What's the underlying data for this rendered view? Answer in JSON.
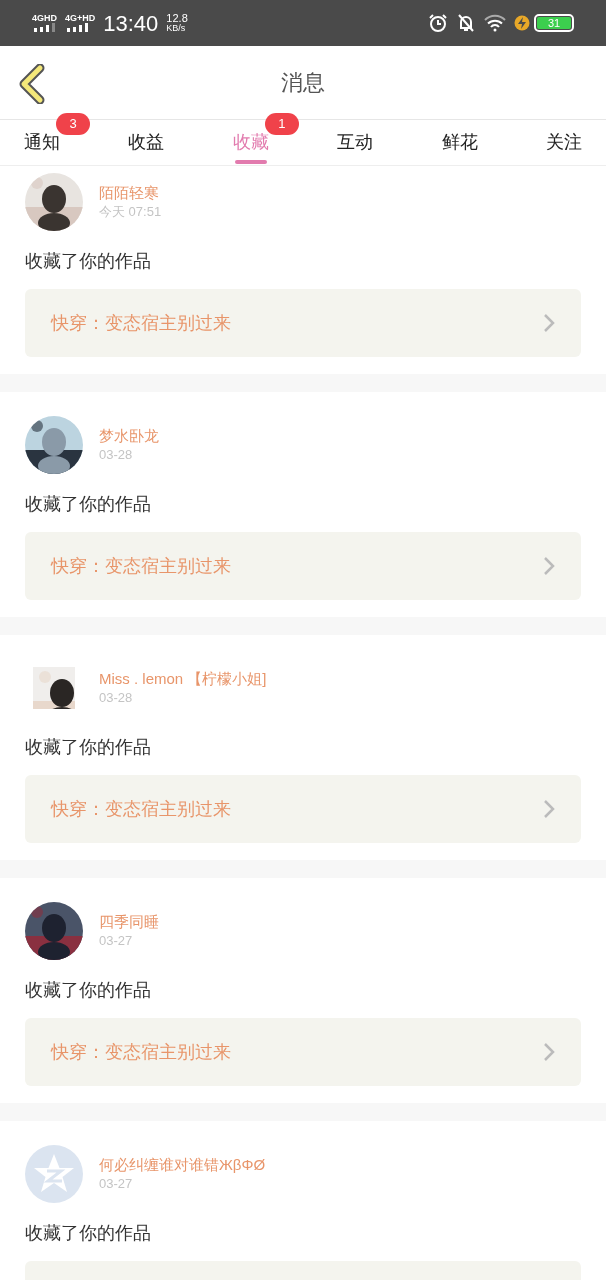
{
  "status_bar": {
    "network_1": "4GHD",
    "network_2": "4G+HD",
    "time": "13:40",
    "speed_value": "12.8",
    "speed_unit": "KB/s",
    "battery": "31"
  },
  "header": {
    "title": "消息"
  },
  "tabs": [
    {
      "label": "通知",
      "selected": false,
      "badge": "3"
    },
    {
      "label": "收益",
      "selected": false
    },
    {
      "label": "收藏",
      "selected": true,
      "badge": "1"
    },
    {
      "label": "互动",
      "selected": false
    },
    {
      "label": "鲜花",
      "selected": false
    },
    {
      "label": "关注",
      "selected": false
    }
  ],
  "messages": [
    {
      "avatar": {
        "kind": "round_photo"
      },
      "name": "陌陌轻寒",
      "time": "今天 07:51",
      "text": "收藏了你的作品",
      "book": "快穿：变态宿主别过来"
    },
    {
      "avatar": {
        "kind": "round_photo"
      },
      "name": "梦水卧龙",
      "time": "03-28",
      "text": "收藏了你的作品",
      "book": "快穿：变态宿主别过来"
    },
    {
      "avatar": {
        "kind": "square_photo"
      },
      "name": "Miss . lemon 【柠檬小姐]",
      "time": "03-28",
      "text": "收藏了你的作品",
      "book": "快穿：变态宿主别过来"
    },
    {
      "avatar": {
        "kind": "round_photo"
      },
      "name": "四季同睡",
      "time": "03-27",
      "text": "收藏了你的作品",
      "book": "快穿：变态宿主别过来"
    },
    {
      "avatar": {
        "kind": "default"
      },
      "name": "何必纠缠谁对谁错ЖβΦØ",
      "time": "03-27",
      "text": "收藏了你的作品"
    }
  ]
}
